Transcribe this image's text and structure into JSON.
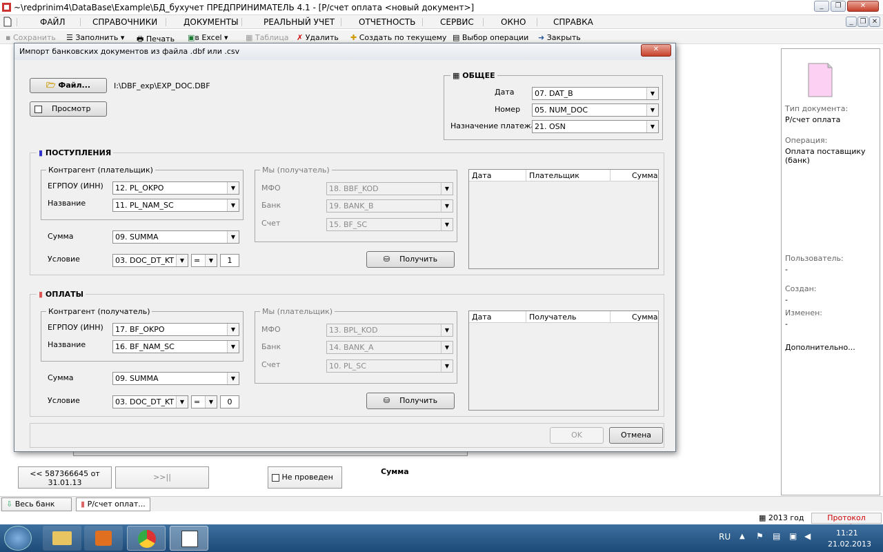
{
  "window": {
    "title": "~\\redprinim4\\DataBase\\Example\\БД_бухучет  ПРЕДПРИНИМАТЕЛЬ 4.1 - [Р/счет оплата <новый документ>]"
  },
  "menu": [
    "ФАЙЛ",
    "СПРАВОЧНИКИ",
    "ДОКУМЕНТЫ",
    "РЕАЛЬНЫЙ УЧЕТ",
    "ОТЧЕТНОСТЬ",
    "СЕРВИС",
    "ОКНО",
    "СПРАВКА"
  ],
  "toolbar": {
    "save": "Сохранить",
    "fill": "Заполнить",
    "print": "Печать",
    "excel": "в Excel",
    "table": "Таблица",
    "delete": "Удалить",
    "create_current": "Создать по текущему",
    "choose_op": "Выбор операции",
    "close": "Закрыть"
  },
  "dialog": {
    "title": "Импорт банковских документов из файла  .dbf  или  .csv",
    "file_button": "Файл...",
    "file_path": "I:\\DBF_exp\\EXP_DOC.DBF",
    "preview_label": "Просмотр",
    "general": {
      "title": "ОБЩЕЕ",
      "date_label": "Дата",
      "date_value": "07. DAT_B",
      "number_label": "Номер",
      "number_value": "05. NUM_DOC",
      "purpose_label": "Назначение платежа",
      "purpose_value": "21. OSN"
    },
    "income": {
      "title": "ПОСТУПЛЕНИЯ",
      "contractor_title": "Контрагент (плательщик)",
      "edrpou_label": "ЕГРПОУ (ИНН)",
      "edrpou_value": "12. PL_OKPO",
      "name_label": "Название",
      "name_value": "11. PL_NAM_SC",
      "we_title": "Мы (получатель)",
      "mfo_label": "МФО",
      "mfo_value": "18. BBF_KOD",
      "bank_label": "Банк",
      "bank_value": "19. BANK_B",
      "account_label": "Счет",
      "account_value": "15. BF_SC",
      "sum_label": "Сумма",
      "sum_value": "09. SUMMA",
      "cond_label": "Условие",
      "cond_value": "03. DOC_DT_KT",
      "cond_op": "=",
      "cond_num": "1",
      "get_button": "Получить",
      "cols": [
        "Дата",
        "Плательщик",
        "Сумма"
      ]
    },
    "payments": {
      "title": "ОПЛАТЫ",
      "contractor_title": "Контрагент (получатель)",
      "edrpou_label": "ЕГРПОУ (ИНН)",
      "edrpou_value": "17. BF_OKPO",
      "name_label": "Название",
      "name_value": "16. BF_NAM_SC",
      "we_title": "Мы (плательщик)",
      "mfo_label": "МФО",
      "mfo_value": "13. BPL_KOD",
      "bank_label": "Банк",
      "bank_value": "14. BANK_A",
      "account_label": "Счет",
      "account_value": "10. PL_SC",
      "sum_label": "Сумма",
      "sum_value": "09. SUMMA",
      "cond_label": "Условие",
      "cond_value": "03. DOC_DT_KT",
      "cond_op": "=",
      "cond_num": "0",
      "get_button": "Получить",
      "cols": [
        "Дата",
        "Получатель",
        "Сумма"
      ]
    },
    "ok": "OK",
    "cancel": "Отмена"
  },
  "right_panel": {
    "doc_type_label": "Тип документа:",
    "doc_type_value": "Р/счет оплата",
    "operation_label": "Операция:",
    "operation_value": "Оплата поставщику (банк)",
    "user_label": "Пользователь:",
    "user_value": "-",
    "created_label": "Создан:",
    "created_value": "-",
    "changed_label": "Изменен:",
    "changed_value": "-",
    "additional": "Дополнительно..."
  },
  "bottom": {
    "prev_button": "<< 587366645 от 31.01.13",
    "next_button": ">>||",
    "not_posted": "Не проведен",
    "sum_label": "Сумма"
  },
  "tabs": [
    "Весь банк",
    "Р/счет оплат..."
  ],
  "status": {
    "year": "2013 год",
    "errors": "Протокол ошибок"
  },
  "taskbar": {
    "lang": "RU",
    "time": "11:21",
    "date": "21.02.2013"
  },
  "colors": {
    "errors_text": "#cc0000",
    "taskbar": "#2a5a8a",
    "dialog_close": "#c7402a"
  }
}
